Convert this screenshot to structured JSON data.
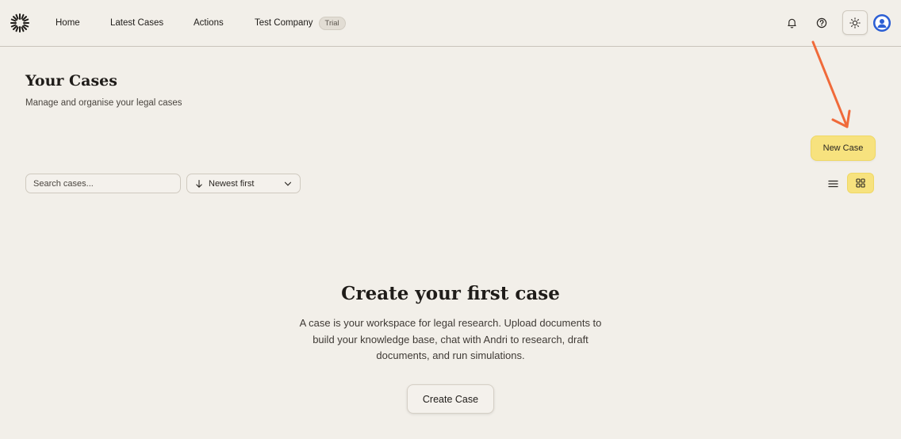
{
  "nav": {
    "home": "Home",
    "latest_cases": "Latest Cases",
    "actions": "Actions",
    "company": "Test Company",
    "trial_badge": "Trial"
  },
  "icons": {
    "logo": "sunburst-logo-icon",
    "notifications": "bell-icon",
    "help": "question-circle-icon",
    "theme": "sun-icon",
    "avatar": "user-avatar-icon",
    "sort_direction": "arrow-down-icon",
    "dropdown": "chevron-down-icon",
    "list_view": "list-icon",
    "grid_view": "grid-icon"
  },
  "colors": {
    "background": "#f2efe9",
    "accent_yellow": "#f7e27e",
    "annotation_arrow": "#f06a3a",
    "avatar_blue": "#2c5fd4"
  },
  "page": {
    "title": "Your Cases",
    "subtitle": "Manage and organise your legal cases"
  },
  "toolbar": {
    "new_case_label": "New Case",
    "search_placeholder": "Search cases...",
    "sort_label": "Newest first"
  },
  "empty_state": {
    "title": "Create your first case",
    "description": "A case is your workspace for legal research. Upload documents to build your knowledge base, chat with Andri to research, draft documents, and run simulations.",
    "button_label": "Create Case"
  }
}
